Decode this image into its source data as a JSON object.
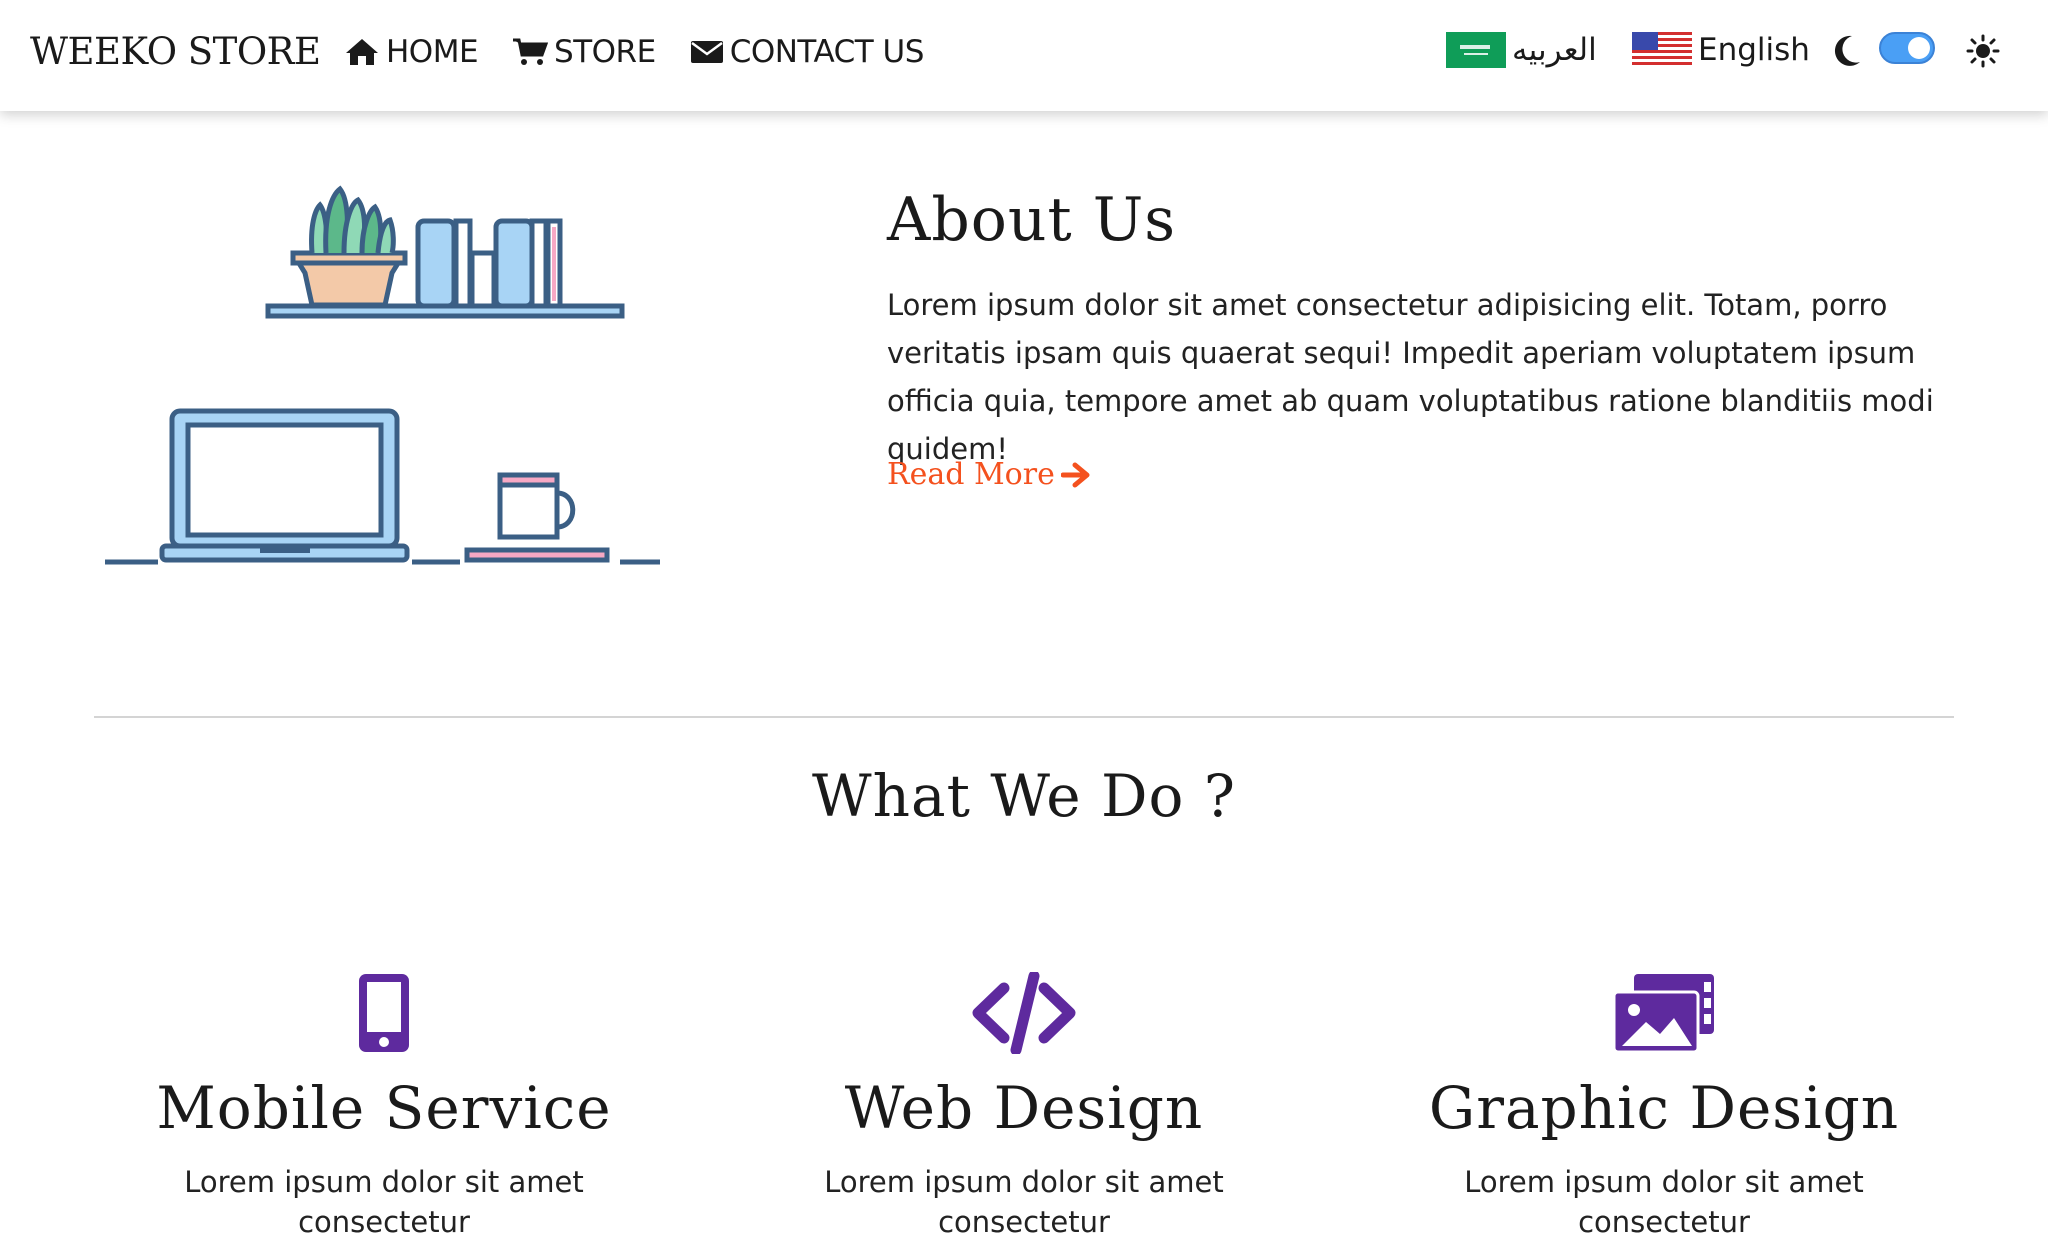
{
  "navbar": {
    "brand": "WEEKO STORE",
    "links": [
      {
        "label": "HOME",
        "icon": "home-icon"
      },
      {
        "label": "STORE",
        "icon": "cart-icon"
      },
      {
        "label": "CONTACT US",
        "icon": "envelope-icon"
      }
    ],
    "languages": [
      {
        "label": "العربيه",
        "icon": "saudi-flag-icon"
      },
      {
        "label": "English",
        "icon": "us-flag-icon"
      }
    ],
    "theme_toggle": {
      "state": "on",
      "dark_icon": "moon-icon",
      "light_icon": "sun-icon"
    }
  },
  "about": {
    "title": "About Us",
    "body": "Lorem ipsum dolor sit amet consectetur adipisicing elit. Totam, porro veritatis ipsam quis quaerat sequi! Impedit aperiam voluptatem ipsum officia quia, tempore amet ab quam voluptatibus ratione blanditiis modi quidem!",
    "read_more": "Read More"
  },
  "services_section": {
    "title": "What We Do ?",
    "items": [
      {
        "title": "Mobile Service",
        "icon": "mobile-icon",
        "text": "Lorem ipsum dolor sit amet consectetur"
      },
      {
        "title": "Web Design",
        "icon": "code-icon",
        "text": "Lorem ipsum dolor sit amet consectetur"
      },
      {
        "title": "Graphic Design",
        "icon": "images-icon",
        "text": "Lorem ipsum dolor sit amet consectetur"
      }
    ]
  },
  "colors": {
    "accent": "#f4511e",
    "icon_purple": "#5e2a9e",
    "toggle_blue": "#4a9ff5",
    "illustration_stroke": "#3b5f85",
    "illustration_fill": "#a8d4f5"
  }
}
